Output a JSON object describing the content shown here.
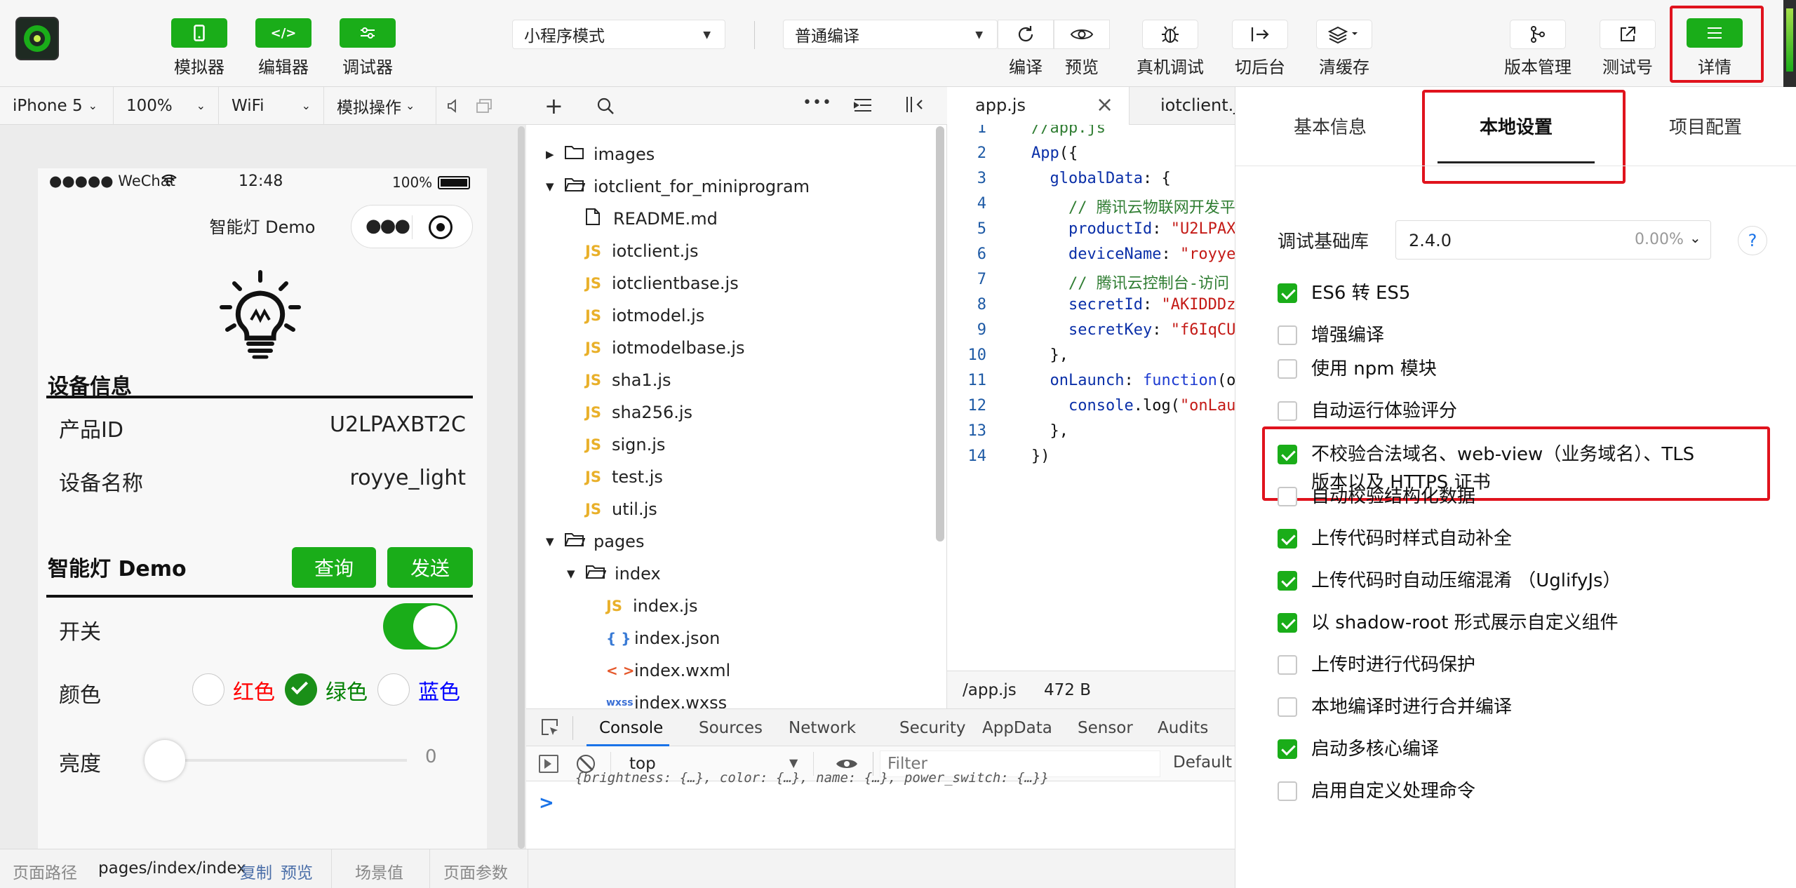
{
  "toolbar": {
    "left": [
      {
        "label": "模拟器",
        "icon": "phone-icon"
      },
      {
        "label": "编辑器",
        "icon": "code-icon"
      },
      {
        "label": "调试器",
        "icon": "sliders-icon"
      }
    ],
    "mode_select": "小程序模式",
    "compile_select": "普通编译",
    "mid": [
      {
        "label": "编译",
        "icon": "refresh-icon"
      },
      {
        "label": "预览",
        "icon": "eye-icon"
      },
      {
        "label": "真机调试",
        "icon": "bug-icon"
      },
      {
        "label": "切后台",
        "icon": "background-icon"
      },
      {
        "label": "清缓存",
        "icon": "layers-icon"
      }
    ],
    "right": [
      {
        "label": "版本管理",
        "icon": "branch-icon"
      },
      {
        "label": "测试号",
        "icon": "external-icon"
      },
      {
        "label": "详情",
        "icon": "menu-icon"
      }
    ]
  },
  "devbar": {
    "device": "iPhone 5",
    "zoom": "100%",
    "network": "WiFi",
    "ops": "模拟操作"
  },
  "phone": {
    "status": {
      "carrier": "●●●●● WeChat",
      "time": "12:48",
      "battery": "100%"
    },
    "nav_title": "智能灯 Demo",
    "section1": "设备信息",
    "rows": [
      {
        "label": "产品ID",
        "value": "U2LPAXBT2C"
      },
      {
        "label": "设备名称",
        "value": "royye_light"
      }
    ],
    "section2": "智能灯 Demo",
    "btn_query": "查询",
    "btn_send": "发送",
    "switch_label": "开关",
    "color_label": "颜色",
    "colors": [
      {
        "name": "红色",
        "color": "#ff0000",
        "checked": false
      },
      {
        "name": "绿色",
        "color": "#008000",
        "checked": true
      },
      {
        "name": "蓝色",
        "color": "#0000ff",
        "checked": false
      }
    ],
    "brightness_label": "亮度",
    "brightness_value": "0"
  },
  "tree": [
    {
      "name": "images",
      "type": "folder",
      "depth": 0,
      "open": false
    },
    {
      "name": "iotclient_for_miniprogram",
      "type": "folder",
      "depth": 0,
      "open": true
    },
    {
      "name": "README.md",
      "type": "file",
      "depth": 1
    },
    {
      "name": "iotclient.js",
      "type": "js",
      "depth": 1
    },
    {
      "name": "iotclientbase.js",
      "type": "js",
      "depth": 1
    },
    {
      "name": "iotmodel.js",
      "type": "js",
      "depth": 1
    },
    {
      "name": "iotmodelbase.js",
      "type": "js",
      "depth": 1
    },
    {
      "name": "sha1.js",
      "type": "js",
      "depth": 1
    },
    {
      "name": "sha256.js",
      "type": "js",
      "depth": 1
    },
    {
      "name": "sign.js",
      "type": "js",
      "depth": 1
    },
    {
      "name": "test.js",
      "type": "js",
      "depth": 1
    },
    {
      "name": "util.js",
      "type": "js",
      "depth": 1
    },
    {
      "name": "pages",
      "type": "folder",
      "depth": 0,
      "open": true
    },
    {
      "name": "index",
      "type": "folder",
      "depth": 1,
      "open": true
    },
    {
      "name": "index.js",
      "type": "js",
      "depth": 2
    },
    {
      "name": "index.json",
      "type": "json",
      "depth": 2
    },
    {
      "name": "index.wxml",
      "type": "wxml",
      "depth": 2
    },
    {
      "name": "index.wxss",
      "type": "wxss",
      "depth": 2
    }
  ],
  "editor": {
    "tabs": [
      "app.js",
      "iotclient.js"
    ],
    "lines": [
      {
        "n": "1",
        "text": "//app.js"
      },
      {
        "n": "2",
        "text": "App({"
      },
      {
        "n": "3",
        "text": "  globalData: {"
      },
      {
        "n": "4",
        "text": "    // 腾讯云物联网开发平"
      },
      {
        "n": "5",
        "text": "    productId: \"U2LPAX"
      },
      {
        "n": "6",
        "text": "    deviceName: \"royye"
      },
      {
        "n": "7",
        "text": "    // 腾讯云控制台-访问"
      },
      {
        "n": "8",
        "text": "    secretId: \"AKIDDDz"
      },
      {
        "n": "9",
        "text": "    secretKey: \"f6IqCU"
      },
      {
        "n": "10",
        "text": "  },"
      },
      {
        "n": "11",
        "text": "  onLaunch: function(o"
      },
      {
        "n": "12",
        "text": "    console.log(\"onLau"
      },
      {
        "n": "13",
        "text": "  },"
      },
      {
        "n": "14",
        "text": "})"
      }
    ],
    "status_path": "/app.js",
    "status_size": "472 B"
  },
  "console": {
    "tabs": [
      "Console",
      "Sources",
      "Network",
      "Security",
      "AppData",
      "Sensor",
      "Audits"
    ],
    "context": "top",
    "filter_placeholder": "Filter",
    "level": "Default",
    "log_line": "{brightness: {…}, color: {…}, name: {…}, power_switch: {…}}",
    "prompt": ">"
  },
  "statusbar": {
    "path_label": "页面路径",
    "path": "pages/index/index",
    "copy": "复制",
    "preview": "预览",
    "scene": "场景值",
    "params": "页面参数"
  },
  "panel": {
    "tabs": [
      "基本信息",
      "本地设置",
      "项目配置"
    ],
    "lib_label": "调试基础库",
    "lib_version": "2.4.0",
    "lib_percent": "0.00%",
    "help": "?",
    "options": [
      {
        "label": "ES6 转 ES5",
        "checked": true
      },
      {
        "label": "增强编译",
        "checked": false
      },
      {
        "label": "使用 npm 模块",
        "checked": false
      },
      {
        "label": "自动运行体验评分",
        "checked": false
      },
      {
        "label": "不校验合法域名、web-view（业务域名）、TLS",
        "label2": "版本以及 HTTPS 证书",
        "checked": true
      },
      {
        "label": "自动校验结构化数据",
        "checked": false
      },
      {
        "label": "上传代码时样式自动补全",
        "checked": true
      },
      {
        "label": "上传代码时自动压缩混淆 （UglifyJs）",
        "checked": true
      },
      {
        "label": "以 shadow-root 形式展示自定义组件",
        "checked": true
      },
      {
        "label": "上传时进行代码保护",
        "checked": false
      },
      {
        "label": "本地编译时进行合并编译",
        "checked": false
      },
      {
        "label": "启动多核心编译",
        "checked": true
      },
      {
        "label": "启用自定义处理命令",
        "checked": false
      }
    ]
  },
  "colors": {
    "green": "#1aad19",
    "highlight": "#e0131d"
  }
}
